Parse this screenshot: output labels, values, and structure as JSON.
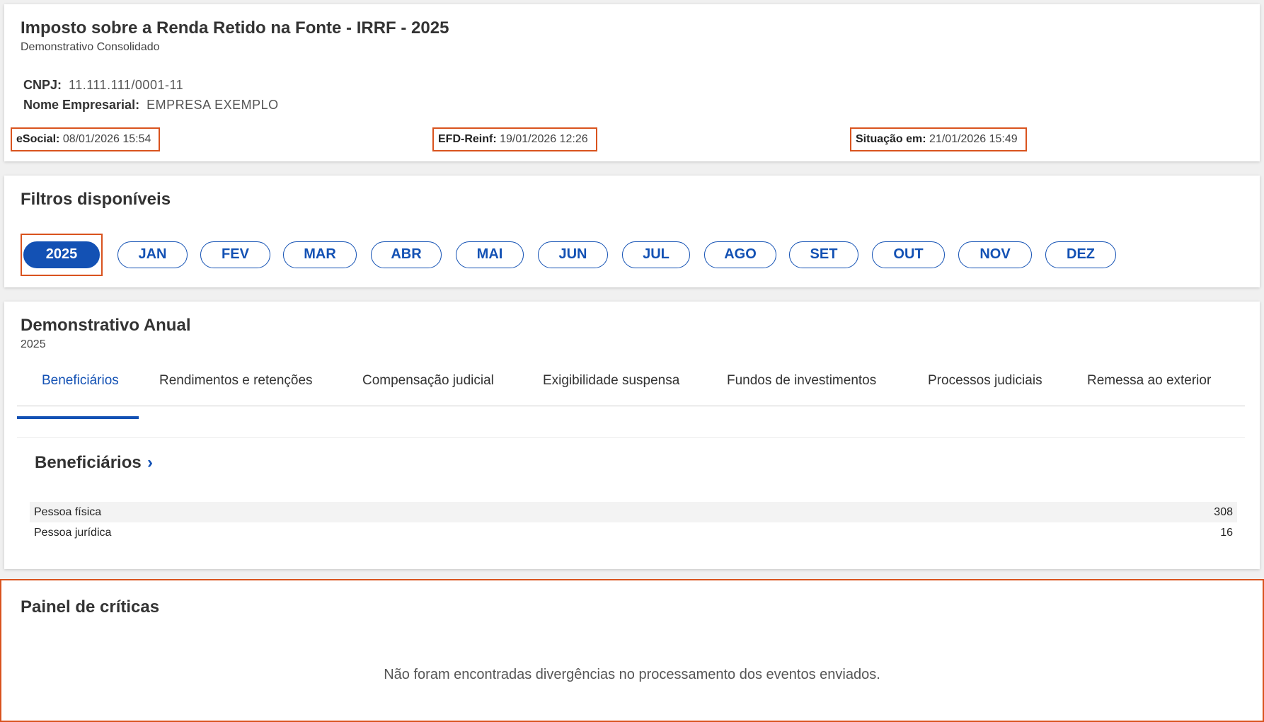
{
  "header": {
    "title": "Imposto sobre a Renda Retido na Fonte - IRRF - 2025",
    "subtitle": "Demonstrativo Consolidado",
    "cnpj_label": "CNPJ:",
    "cnpj_value": "11.111.111/0001-11",
    "nome_label": "Nome Empresarial:",
    "nome_value": "EMPRESA EXEMPLO",
    "stamps": {
      "esocial_label": "eSocial:",
      "esocial_value": "08/01/2026 15:54",
      "efd_label": "EFD-Reinf:",
      "efd_value": "19/01/2026 12:26",
      "situacao_label": "Situação em:",
      "situacao_value": "21/01/2026 15:49"
    }
  },
  "filters": {
    "title": "Filtros disponíveis",
    "year": "2025",
    "months": [
      "JAN",
      "FEV",
      "MAR",
      "ABR",
      "MAI",
      "JUN",
      "JUL",
      "AGO",
      "SET",
      "OUT",
      "NOV",
      "DEZ"
    ],
    "selected": "2025"
  },
  "annual": {
    "title": "Demonstrativo Anual",
    "year": "2025",
    "tabs": [
      "Beneficiários",
      "Rendimentos e retenções",
      "Compensação judicial",
      "Exigibilidade suspensa",
      "Fundos de investimentos",
      "Processos judiciais",
      "Remessa ao exterior"
    ],
    "active_tab": "Beneficiários",
    "section_title": "Beneficiários",
    "chevron": "›",
    "rows": [
      {
        "label": "Pessoa física",
        "value": "308"
      },
      {
        "label": "Pessoa jurídica",
        "value": "16"
      }
    ]
  },
  "criticas": {
    "title": "Painel de críticas",
    "message": "Não foram encontradas divergências no processamento dos eventos enviados."
  },
  "colors": {
    "primary": "#1351b4",
    "highlight_border": "#d9531e"
  }
}
